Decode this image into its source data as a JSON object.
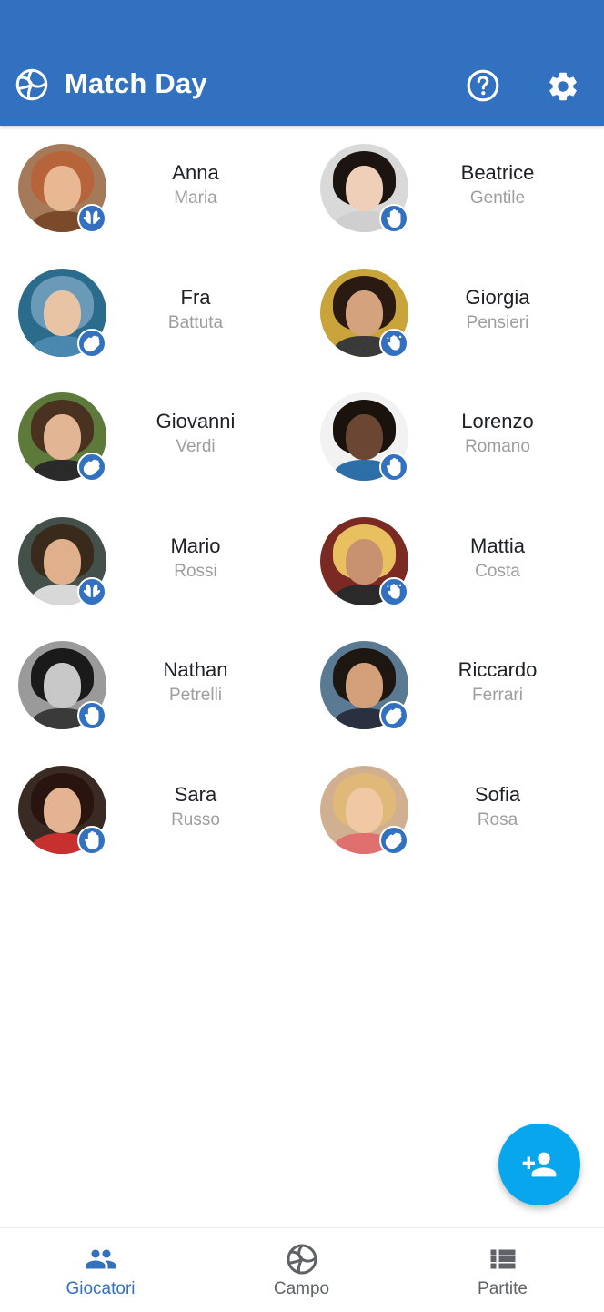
{
  "app_bar": {
    "title": "Match Day",
    "logo_icon": "volleyball-icon",
    "help_icon": "help-circle-icon",
    "settings_icon": "gear-icon",
    "color": "#3270c0"
  },
  "players": [
    {
      "first": "Anna",
      "last": "Maria",
      "role_icon": "two-hands-icon"
    },
    {
      "first": "Beatrice",
      "last": "Gentile",
      "role_icon": "hand-icon"
    },
    {
      "first": "Fra",
      "last": "Battuta",
      "role_icon": "waving-hand-icon"
    },
    {
      "first": "Giorgia",
      "last": "Pensieri",
      "role_icon": "hand-spark-icon"
    },
    {
      "first": "Giovanni",
      "last": "Verdi",
      "role_icon": "waving-hand-icon"
    },
    {
      "first": "Lorenzo",
      "last": "Romano",
      "role_icon": "hand-icon"
    },
    {
      "first": "Mario",
      "last": "Rossi",
      "role_icon": "two-hands-icon"
    },
    {
      "first": "Mattia",
      "last": "Costa",
      "role_icon": "hand-spark-icon"
    },
    {
      "first": "Nathan",
      "last": "Petrelli",
      "role_icon": "hand-icon"
    },
    {
      "first": "Riccardo",
      "last": "Ferrari",
      "role_icon": "waving-hand-icon"
    },
    {
      "first": "Sara",
      "last": "Russo",
      "role_icon": "hand-icon"
    },
    {
      "first": "Sofia",
      "last": "Rosa",
      "role_icon": "waving-hand-icon"
    }
  ],
  "fab": {
    "icon": "add-person-icon",
    "color": "#08a6ec"
  },
  "bottom_nav": {
    "items": [
      {
        "label": "Giocatori",
        "icon": "people-icon",
        "active": true
      },
      {
        "label": "Campo",
        "icon": "volleyball-icon",
        "active": false
      },
      {
        "label": "Partite",
        "icon": "list-icon",
        "active": false
      }
    ],
    "active_color": "#3270c0",
    "inactive_color": "#5f6368"
  }
}
